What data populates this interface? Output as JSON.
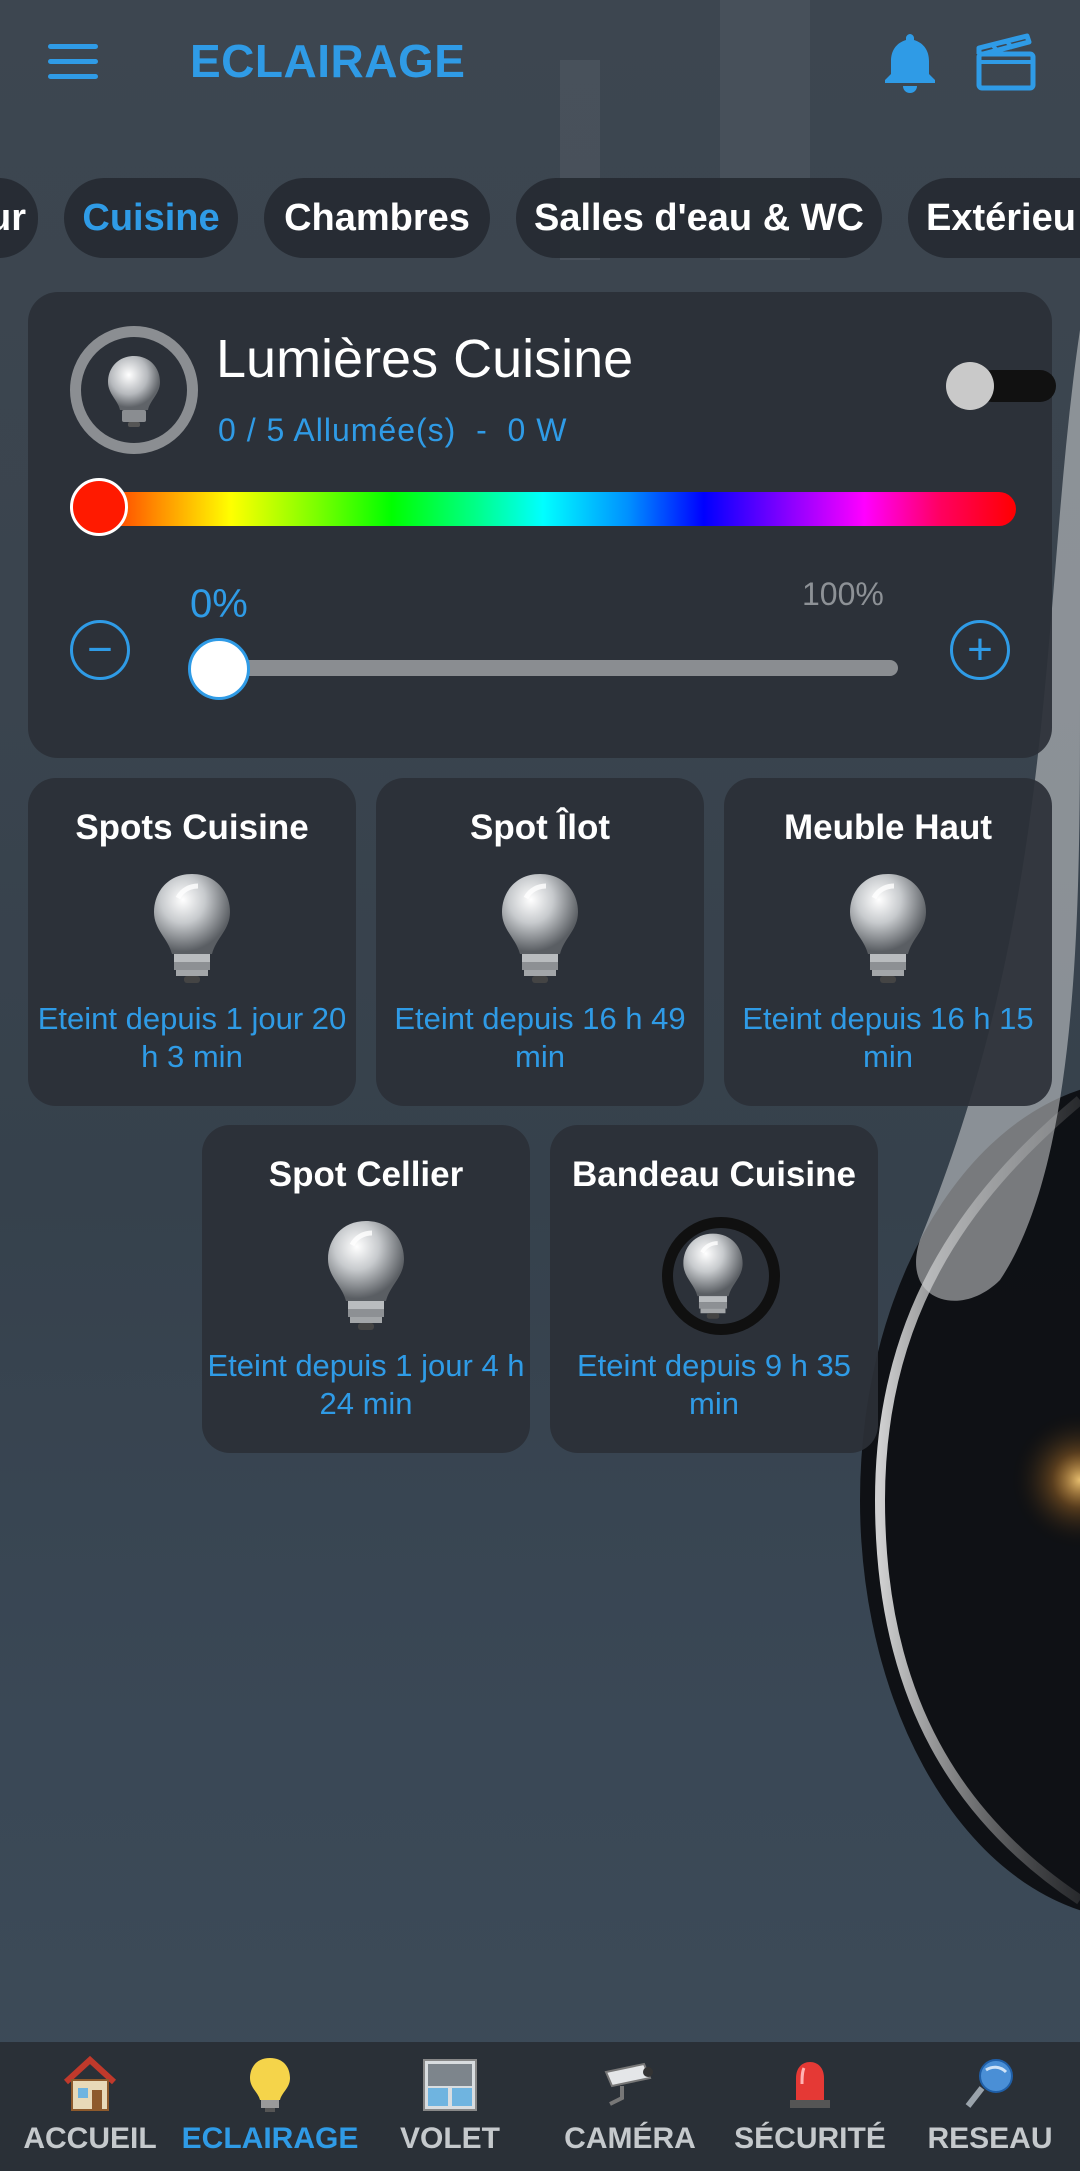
{
  "app": {
    "title": "ECLAIRAGE"
  },
  "header": {
    "menu_icon": "hamburger-menu-icon",
    "notification_icon": "bell-icon",
    "scene_icon": "clapperboard-icon"
  },
  "tabs": [
    {
      "label": "Séjour",
      "visible_text": "ur",
      "active": false
    },
    {
      "label": "Cuisine",
      "active": true
    },
    {
      "label": "Chambres",
      "active": false
    },
    {
      "label": "Salles d'eau & WC",
      "active": false
    },
    {
      "label": "Extérieur",
      "visible_text": "Extérieu",
      "active": false
    }
  ],
  "group": {
    "title": "Lumières Cuisine",
    "status": "0 / 5 Allumée(s)  -  0 W",
    "on": false,
    "color": "#ff1a00",
    "brightness_percent": 0,
    "brightness_label": "0%",
    "max_label": "100%",
    "minus_symbol": "−",
    "plus_symbol": "+"
  },
  "devices": [
    {
      "name": "Spots Cuisine",
      "status": "Eteint depuis 1 jour 20 h 3 min",
      "selected": false
    },
    {
      "name": "Spot Îlot",
      "status": "Eteint depuis 16 h 49 min",
      "selected": false
    },
    {
      "name": "Meuble Haut",
      "status": "Eteint depuis 16 h 15 min",
      "selected": false
    },
    {
      "name": "Spot Cellier",
      "status": "Eteint depuis 1 jour 4 h 24 min",
      "selected": false
    },
    {
      "name": "Bandeau Cuisine",
      "status": "Eteint depuis 9 h 35 min",
      "selected": true
    }
  ],
  "nav": [
    {
      "label": "ACCUEIL",
      "icon": "house-icon",
      "active": false
    },
    {
      "label": "ECLAIRAGE",
      "icon": "lightbulb-icon",
      "active": true
    },
    {
      "label": "VOLET",
      "icon": "window-shutter-icon",
      "active": false
    },
    {
      "label": "CAMÉRA",
      "icon": "cctv-camera-icon",
      "active": false
    },
    {
      "label": "SÉCURITÉ",
      "icon": "siren-icon",
      "active": false
    },
    {
      "label": "RESEAU",
      "icon": "network-icon",
      "active": false
    }
  ],
  "colors": {
    "accent": "#2f9be6",
    "card": "#2b3037",
    "nav_bg": "#2a3037"
  }
}
